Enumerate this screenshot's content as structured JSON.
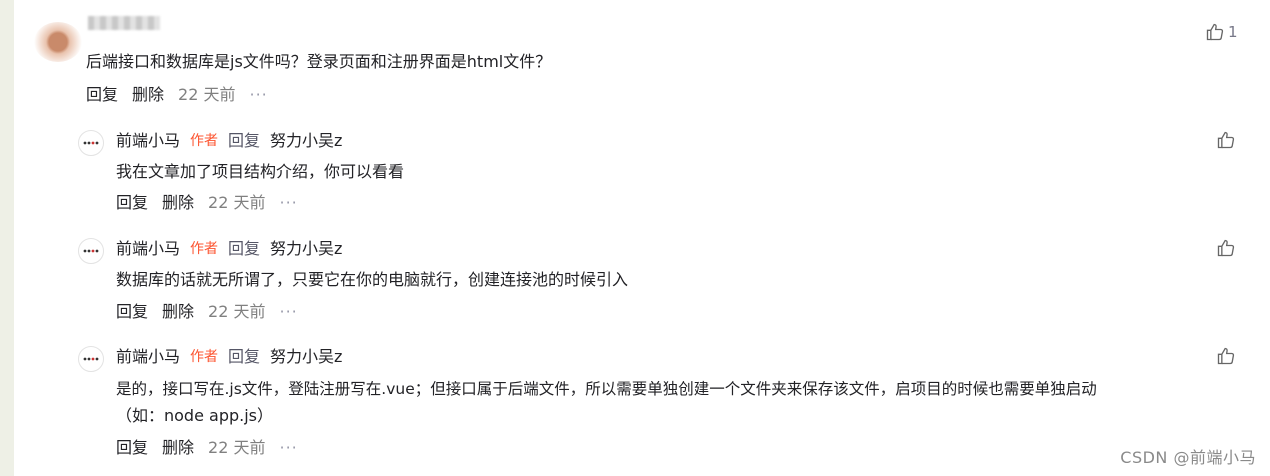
{
  "main_comment": {
    "text": "后端接口和数据库是js文件吗？登录页面和注册界面是html文件？",
    "likes": "1",
    "reply_label": "回复",
    "delete_label": "删除",
    "time": "22 天前",
    "more": "···"
  },
  "replies": [
    {
      "author": "前端小马",
      "badge": "作者",
      "reply_word": "回复",
      "target": "努力小吴z",
      "text": "我在文章加了项目结构介绍，你可以看看",
      "reply_label": "回复",
      "delete_label": "删除",
      "time": "22 天前",
      "more": "···"
    },
    {
      "author": "前端小马",
      "badge": "作者",
      "reply_word": "回复",
      "target": "努力小吴z",
      "text": "数据库的话就无所谓了，只要它在你的电脑就行，创建连接池的时候引入",
      "reply_label": "回复",
      "delete_label": "删除",
      "time": "22 天前",
      "more": "···"
    },
    {
      "author": "前端小马",
      "badge": "作者",
      "reply_word": "回复",
      "target": "努力小吴z",
      "text": "是的，接口写在.js文件，登陆注册写在.vue；但接口属于后端文件，所以需要单独创建一个文件夹来保存该文件，启项目的时候也需要单独启动",
      "text_line2": "（如：node app.js）",
      "reply_label": "回复",
      "delete_label": "删除",
      "time": "22 天前",
      "more": "···"
    }
  ],
  "watermark": "CSDN @前端小马",
  "colors": {
    "badge": "#fc5531",
    "text": "#222226",
    "muted": "#808080"
  },
  "icons": {
    "like": "thumbs-up-icon",
    "more": "more-dots-icon"
  }
}
